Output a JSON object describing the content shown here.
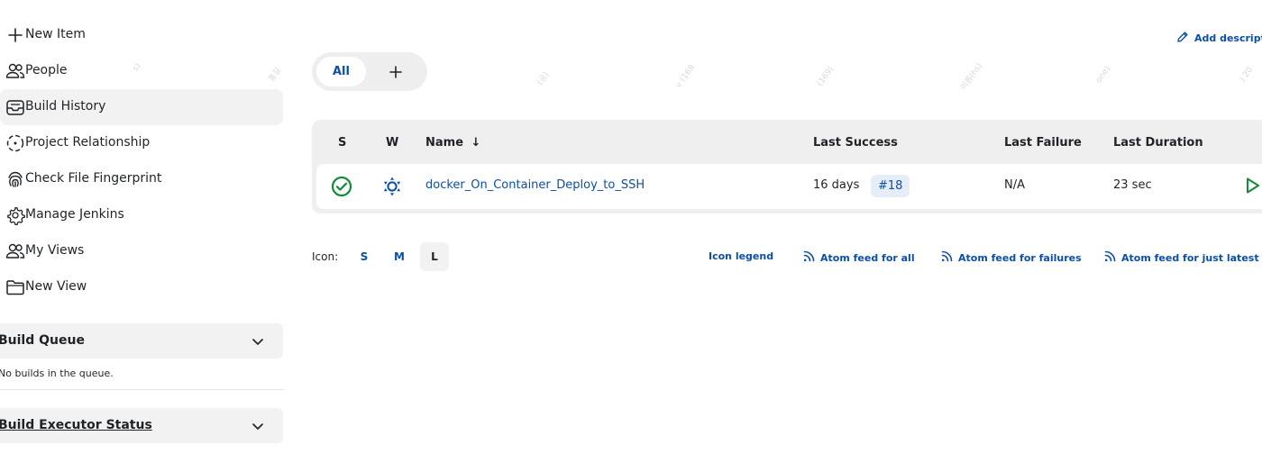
{
  "sidebar": {
    "tasks": [
      {
        "label": "New Item",
        "icon": "plus-icon"
      },
      {
        "label": "People",
        "icon": "people-icon"
      },
      {
        "label": "Build History",
        "icon": "inbox-icon"
      },
      {
        "label": "Project Relationship",
        "icon": "relationship-icon"
      },
      {
        "label": "Check File Fingerprint",
        "icon": "fingerprint-icon"
      },
      {
        "label": "Manage Jenkins",
        "icon": "gear-icon"
      },
      {
        "label": "My Views",
        "icon": "people-icon"
      },
      {
        "label": "New View",
        "icon": "folder-icon"
      }
    ],
    "build_queue": {
      "title": "Build Queue",
      "empty_text": "No builds in the queue."
    },
    "executor_status": {
      "title": "Build Executor Status"
    }
  },
  "main": {
    "add_description": "Add description",
    "tabs": [
      {
        "label": "All"
      }
    ],
    "table": {
      "headers": {
        "s": "S",
        "w": "W",
        "name": "Name",
        "name_sort": "↓",
        "last_success": "Last Success",
        "last_failure": "Last Failure",
        "last_duration": "Last Duration"
      },
      "rows": [
        {
          "name": "docker_On_Container_Deploy_to_SSH",
          "last_success": "16 days",
          "last_success_build": "#18",
          "last_failure": "N/A",
          "last_duration": "23 sec",
          "status": "success",
          "weather": "sunny"
        }
      ]
    },
    "footer": {
      "icon_label": "Icon:",
      "sizes": [
        "S",
        "M",
        "L"
      ],
      "active_size": "L",
      "icon_legend": "Icon legend",
      "feed_all": "Atom feed for all",
      "feed_failures": "Atom feed for failures",
      "feed_latest": "Atom feed for just latest builds"
    }
  },
  "colors": {
    "link": "#0b4fa8",
    "success": "#138a36",
    "pane_bg": "#f2f2f2"
  }
}
